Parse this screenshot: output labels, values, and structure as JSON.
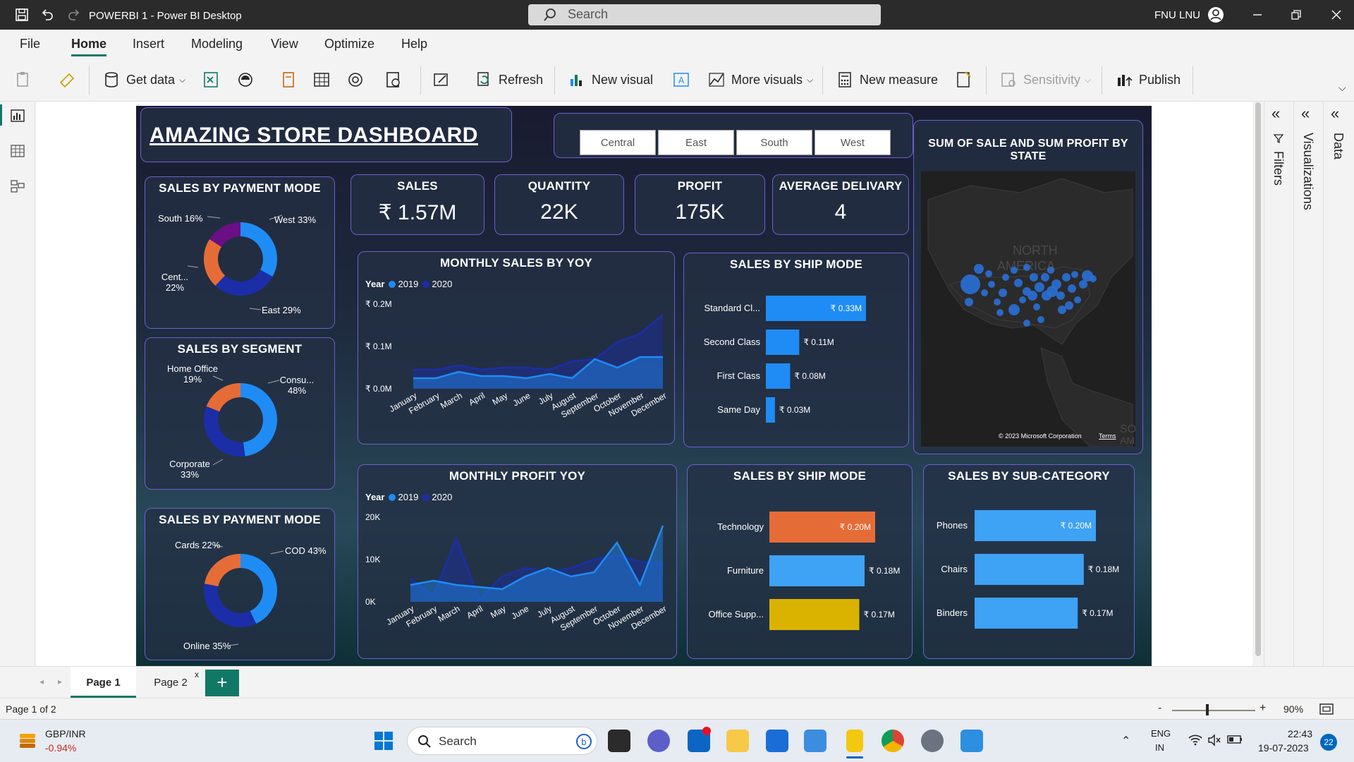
{
  "window": {
    "title": "POWERBI 1 - Power BI Desktop",
    "search_placeholder": "Search",
    "user": "FNU LNU"
  },
  "menu": [
    "File",
    "Home",
    "Insert",
    "Modeling",
    "View",
    "Optimize",
    "Help"
  ],
  "ribbon": {
    "get_data": "Get data",
    "refresh": "Refresh",
    "new_visual": "New visual",
    "more_visuals": "More visuals",
    "new_measure": "New measure",
    "sensitivity": "Sensitivity",
    "publish": "Publish"
  },
  "right_panels": {
    "filters": "Filters",
    "visualizations": "Visualizations",
    "data": "Data"
  },
  "dashboard": {
    "title": "AMAZING STORE DASHBOARD",
    "regions": [
      "Central",
      "East",
      "South",
      "West"
    ],
    "kpis": [
      {
        "label": "SALES",
        "value": "₹ 1.57M"
      },
      {
        "label": "QUANTITY",
        "value": "22K"
      },
      {
        "label": "PROFIT",
        "value": "175K"
      },
      {
        "label": "AVERAGE DELIVARY",
        "value": "4"
      }
    ],
    "payment_region": {
      "title": "SALES BY PAYMENT MODE",
      "slices": [
        {
          "label": "West 33%",
          "value": 33,
          "color": "#1f8cf5"
        },
        {
          "label": "East 29%",
          "value": 29,
          "color": "#1b2ea8"
        },
        {
          "label": "Cent... 22%",
          "line1": "Cent...",
          "line2": "22%",
          "value": 22,
          "color": "#e66c37"
        },
        {
          "label": "South 16%",
          "value": 16,
          "color": "#6b0f84"
        }
      ]
    },
    "segment": {
      "title": "SALES BY SEGMENT",
      "slices": [
        {
          "label": "Consu... 48%",
          "line1": "Consu...",
          "line2": "48%",
          "value": 48,
          "color": "#1f8cf5"
        },
        {
          "label": "Corporate 33%",
          "line1": "Corporate",
          "line2": "33%",
          "value": 33,
          "color": "#1b2ea8"
        },
        {
          "label": "Home Office 19%",
          "line1": "Home Office",
          "line2": "19%",
          "value": 19,
          "color": "#e66c37"
        }
      ]
    },
    "payment_mode": {
      "title": "SALES BY PAYMENT MODE",
      "slices": [
        {
          "label": "COD 43%",
          "value": 43,
          "color": "#1f8cf5"
        },
        {
          "label": "Online 35%",
          "value": 35,
          "color": "#1b2ea8"
        },
        {
          "label": "Cards 22%",
          "value": 22,
          "color": "#e66c37"
        }
      ]
    },
    "monthly_sales": {
      "title": "MONTHLY SALES BY YOY",
      "legend_title": "Year",
      "y_ticks": [
        "₹ 0.2M",
        "₹ 0.1M",
        "₹ 0.0M"
      ]
    },
    "ship_mode": {
      "title": "SALES BY SHIP MODE",
      "bars": [
        {
          "label": "Standard Cl...",
          "value_label": "₹ 0.33M",
          "value": 0.33
        },
        {
          "label": "Second Class",
          "value_label": "₹ 0.11M",
          "value": 0.11
        },
        {
          "label": "First Class",
          "value_label": "₹ 0.08M",
          "value": 0.08
        },
        {
          "label": "Same Day",
          "value_label": "₹ 0.03M",
          "value": 0.03
        }
      ]
    },
    "map": {
      "title": "SUM OF SALE AND SUM PROFIT BY STATE",
      "continent_label": "NORTH AMERICA",
      "continent_line1": "NORTH",
      "continent_line2": "AMERICA",
      "south_fragment": "SOUT",
      "south_fragment2": "AMER",
      "copyright": "© 2023 Microsoft Corporation",
      "terms": "Terms"
    },
    "monthly_profit": {
      "title": "MONTHLY PROFIT YOY",
      "legend_title": "Year",
      "y_ticks": [
        "20K",
        "10K",
        "0K"
      ]
    },
    "category": {
      "title": "SALES BY SHIP MODE",
      "bars": [
        {
          "label": "Technology",
          "value_label": "₹ 0.20M",
          "value": 0.2,
          "color": "#e66c37"
        },
        {
          "label": "Furniture",
          "value_label": "₹ 0.18M",
          "value": 0.18,
          "color": "#3ea2f5"
        },
        {
          "label": "Office Supp...",
          "value_label": "₹ 0.17M",
          "value": 0.17,
          "color": "#d9b300"
        }
      ]
    },
    "subcategory": {
      "title": "SALES BY SUB-CATEGORY",
      "bars": [
        {
          "label": "Phones",
          "value_label": "₹ 0.20M",
          "value": 0.2
        },
        {
          "label": "Chairs",
          "value_label": "₹ 0.18M",
          "value": 0.18
        },
        {
          "label": "Binders",
          "value_label": "₹ 0.17M",
          "value": 0.17
        }
      ]
    }
  },
  "chart_data": [
    {
      "type": "area",
      "title": "MONTHLY SALES BY YOY",
      "x": [
        "January",
        "February",
        "March",
        "April",
        "May",
        "June",
        "July",
        "August",
        "September",
        "October",
        "November",
        "December"
      ],
      "series": [
        {
          "name": "2019",
          "color": "#1f8cf5",
          "values": [
            0.025,
            0.025,
            0.04,
            0.03,
            0.03,
            0.025,
            0.035,
            0.025,
            0.07,
            0.05,
            0.075,
            0.075
          ]
        },
        {
          "name": "2020",
          "color": "#1b2ea8",
          "values": [
            0.045,
            0.045,
            0.055,
            0.045,
            0.05,
            0.05,
            0.045,
            0.065,
            0.07,
            0.11,
            0.13,
            0.175
          ]
        }
      ],
      "ylim": [
        0,
        0.2
      ],
      "y_unit": "₹ M"
    },
    {
      "type": "area",
      "title": "MONTHLY PROFIT YOY",
      "x": [
        "January",
        "February",
        "March",
        "April",
        "May",
        "June",
        "July",
        "August",
        "September",
        "October",
        "November",
        "December"
      ],
      "series": [
        {
          "name": "2019",
          "color": "#1f8cf5",
          "values": [
            4000,
            5000,
            4000,
            3500,
            3000,
            6000,
            8000,
            6000,
            7000,
            14000,
            4000,
            18000
          ]
        },
        {
          "name": "2020",
          "color": "#1b2ea8",
          "values": [
            5500,
            1500,
            15000,
            500,
            6000,
            8000,
            7000,
            8000,
            10000,
            11000,
            9500,
            9000
          ]
        }
      ],
      "ylim": [
        0,
        20000
      ]
    },
    {
      "type": "pie",
      "title": "SALES BY PAYMENT MODE",
      "categories": [
        "West",
        "East",
        "Central",
        "South"
      ],
      "values": [
        33,
        29,
        22,
        16
      ]
    },
    {
      "type": "pie",
      "title": "SALES BY SEGMENT",
      "categories": [
        "Consumer",
        "Corporate",
        "Home Office"
      ],
      "values": [
        48,
        33,
        19
      ]
    },
    {
      "type": "pie",
      "title": "SALES BY PAYMENT MODE",
      "categories": [
        "COD",
        "Online",
        "Cards"
      ],
      "values": [
        43,
        35,
        22
      ]
    },
    {
      "type": "bar",
      "title": "SALES BY SHIP MODE",
      "categories": [
        "Standard Cl...",
        "Second Class",
        "First Class",
        "Same Day"
      ],
      "values": [
        0.33,
        0.11,
        0.08,
        0.03
      ]
    },
    {
      "type": "bar",
      "title": "SALES BY SHIP MODE",
      "categories": [
        "Technology",
        "Furniture",
        "Office Supp..."
      ],
      "values": [
        0.2,
        0.18,
        0.17
      ]
    },
    {
      "type": "bar",
      "title": "SALES BY SUB-CATEGORY",
      "categories": [
        "Phones",
        "Chairs",
        "Binders"
      ],
      "values": [
        0.2,
        0.18,
        0.17
      ]
    }
  ],
  "pages": {
    "tab1": "Page 1",
    "tab2": "Page 2",
    "close": "x",
    "add": "+"
  },
  "status": {
    "page_info": "Page 1 of 2",
    "zoom": "90%",
    "zoom_minus": "-",
    "zoom_plus": "+"
  },
  "taskbar": {
    "ticker": "GBP/INR",
    "ticker_change": "-0.94%",
    "search": "Search",
    "lang1": "ENG",
    "lang2": "IN",
    "time": "22:43",
    "date": "19-07-2023",
    "badge": "22"
  }
}
